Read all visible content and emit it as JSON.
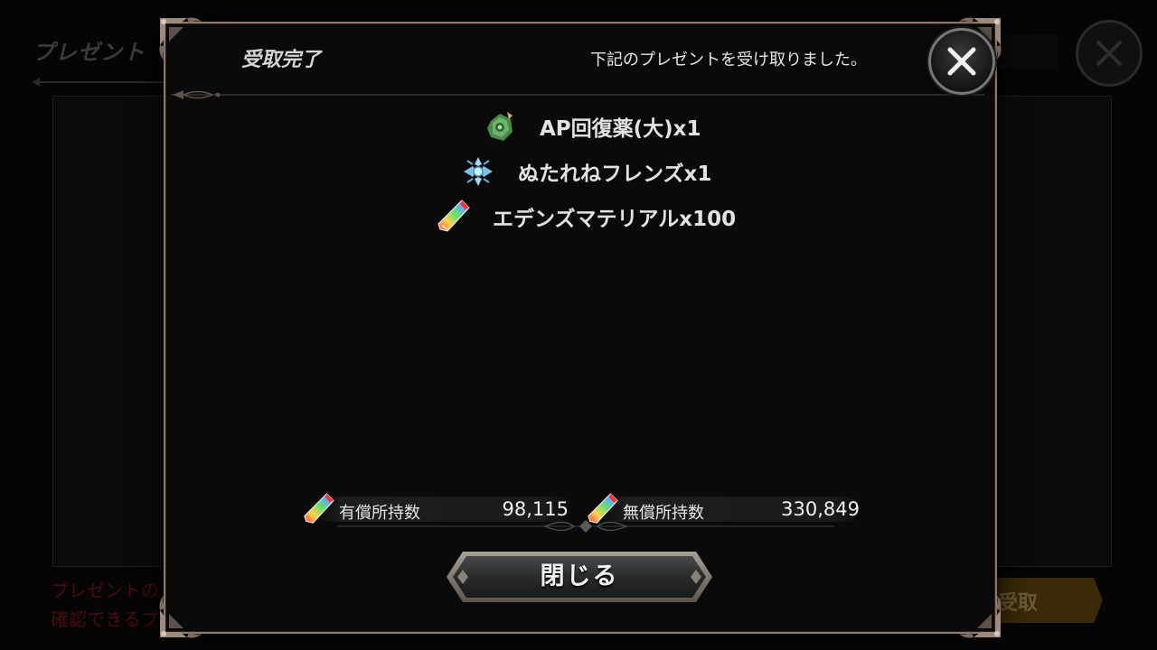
{
  "background": {
    "title": "プレゼント",
    "note_line1": "プレゼントの",
    "note_line2": "確認できるプ",
    "claim_button": "受取"
  },
  "modal": {
    "title": "受取完了",
    "message": "下記のプレゼントを受け取りました。",
    "close_icon": "close-x-icon",
    "rewards": [
      {
        "icon": "ap-potion-icon",
        "label": "AP回復薬(大)x1"
      },
      {
        "icon": "friend-crest-icon",
        "label": "ぬたれねフレンズx1"
      },
      {
        "icon": "rainbow-crystal-icon",
        "label": "エデンズマテリアルx100"
      }
    ],
    "paid_label": "有償所持数",
    "paid_value": "98,115",
    "free_label": "無償所持数",
    "free_value": "330,849",
    "close_button": "閉じる"
  },
  "colors": {
    "frame": "#8e7a6b",
    "text": "#e2e2e2",
    "note_red": "#4a0c0c"
  }
}
